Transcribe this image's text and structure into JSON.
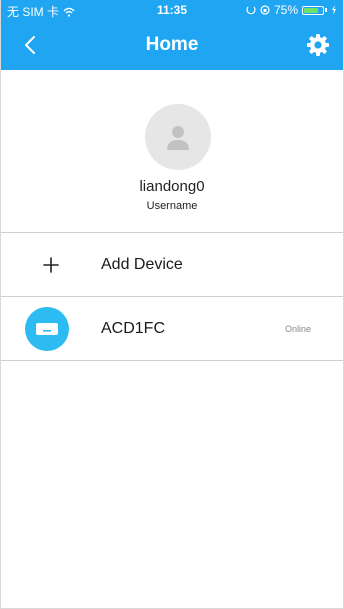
{
  "status_bar": {
    "carrier": "无 SIM 卡",
    "time": "11:35",
    "battery_text": "75%",
    "battery_level": 0.75,
    "icons": [
      "wifi-icon",
      "alarm-icon",
      "lock-rotation-icon",
      "battery-icon",
      "charging-icon"
    ]
  },
  "header": {
    "title": "Home",
    "back_icon": "chevron-left-icon",
    "settings_icon": "gear-icon"
  },
  "profile": {
    "name": "liandong0",
    "subtitle": "Username",
    "avatar_icon": "user-silhouette-icon"
  },
  "actions": {
    "add_device_label": "Add Device",
    "add_icon": "plus-icon"
  },
  "devices": [
    {
      "name": "ACD1FC",
      "status": "Online",
      "icon": "air-conditioner-icon"
    }
  ],
  "colors": {
    "primary": "#1fa5f2",
    "device_icon_bg": "#2cbcf1",
    "divider": "#cfcfcf",
    "avatar_bg": "#e6e6e6"
  }
}
